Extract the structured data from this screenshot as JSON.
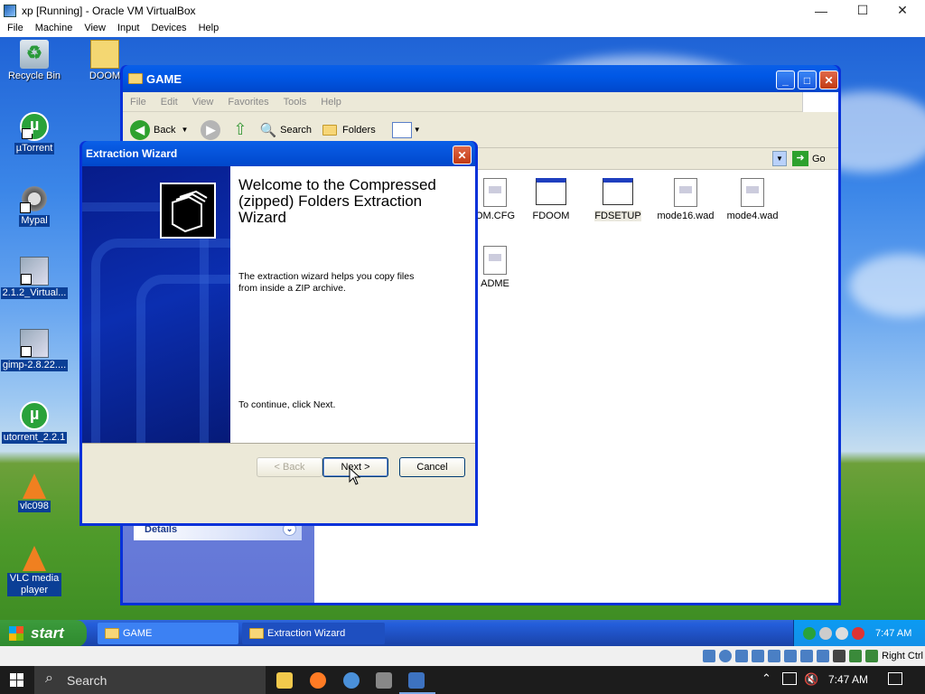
{
  "host": {
    "title": "xp [Running] - Oracle VM VirtualBox",
    "menu": [
      "File",
      "Machine",
      "View",
      "Input",
      "Devices",
      "Help"
    ],
    "controls": {
      "minimize": "—",
      "maximize": "☐",
      "close": "✕"
    },
    "status_right": "Right Ctrl"
  },
  "desktop": {
    "icons": [
      {
        "label": "Recycle Bin",
        "type": "recycle"
      },
      {
        "label": "DOOM",
        "type": "zip"
      },
      {
        "label": "µTorrent",
        "type": "utorrent"
      },
      {
        "label": "Mypal",
        "type": "raccoon"
      },
      {
        "label": "2.1.2_Virtual...",
        "type": "installer"
      },
      {
        "label": "gimp-2.8.22....",
        "type": "installer"
      },
      {
        "label": "utorrent_2.2.1",
        "type": "utorrent"
      },
      {
        "label": "vlc098",
        "type": "vlc"
      },
      {
        "label": "VLC media player",
        "type": "vlc"
      }
    ]
  },
  "explorer": {
    "title": "GAME",
    "menu": [
      "File",
      "Edit",
      "View",
      "Favorites",
      "Tools",
      "Help"
    ],
    "toolbar": {
      "back": "Back",
      "search": "Search",
      "folders": "Folders"
    },
    "go": "Go",
    "files": [
      {
        "name": "OM.CFG",
        "kind": "doc"
      },
      {
        "name": "FDOOM",
        "kind": "app"
      },
      {
        "name": "FDSETUP",
        "kind": "app"
      },
      {
        "name": "mode16.wad",
        "kind": "doc"
      },
      {
        "name": "mode4.wad",
        "kind": "doc"
      },
      {
        "name": "ADME",
        "kind": "doc"
      }
    ],
    "details_label": "Details"
  },
  "wizard": {
    "title": "Extraction Wizard",
    "heading": "Welcome to the Compressed (zipped) Folders Extraction Wizard",
    "description": "The extraction wizard helps you copy files from inside a ZIP archive.",
    "continue_text": "To continue, click Next.",
    "back_label": "< Back",
    "next_label": "Next >",
    "cancel_label": "Cancel"
  },
  "xp_taskbar": {
    "start": "start",
    "tasks": [
      "GAME",
      "Extraction Wizard"
    ],
    "clock": "7:47 AM"
  },
  "win10_taskbar": {
    "search": "Search",
    "clock": "7:47 AM"
  }
}
